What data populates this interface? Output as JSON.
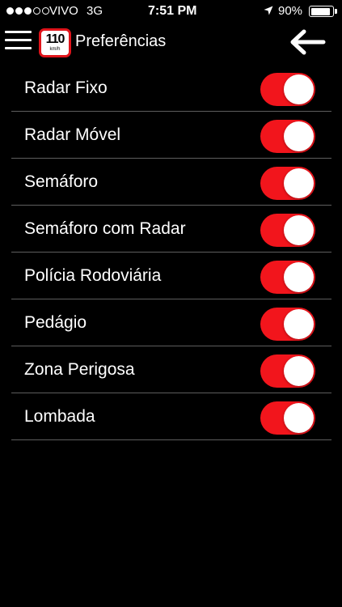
{
  "status_bar": {
    "signal_dots": [
      true,
      true,
      true,
      false,
      false
    ],
    "carrier": "VIVO",
    "network": "3G",
    "time": "7:51 PM",
    "location_icon": "location-arrow-icon",
    "battery_percent": "90%",
    "battery_level": 0.9
  },
  "nav": {
    "title": "Preferências",
    "logo": {
      "speed": "110",
      "unit": "km/h"
    },
    "menu_icon": "hamburger-menu-icon",
    "back_icon": "back-arrow-icon"
  },
  "colors": {
    "background": "#000000",
    "toggle_on": "#f2151c",
    "logo_border": "#e0141b",
    "separator": "#5e5e5e"
  },
  "settings": [
    {
      "label": "Radar Fixo",
      "enabled": true
    },
    {
      "label": "Radar Móvel",
      "enabled": true
    },
    {
      "label": "Semáforo",
      "enabled": true
    },
    {
      "label": "Semáforo com Radar",
      "enabled": true
    },
    {
      "label": "Polícia Rodoviária",
      "enabled": true
    },
    {
      "label": "Pedágio",
      "enabled": true
    },
    {
      "label": "Zona Perigosa",
      "enabled": true
    },
    {
      "label": "Lombada",
      "enabled": true
    }
  ]
}
